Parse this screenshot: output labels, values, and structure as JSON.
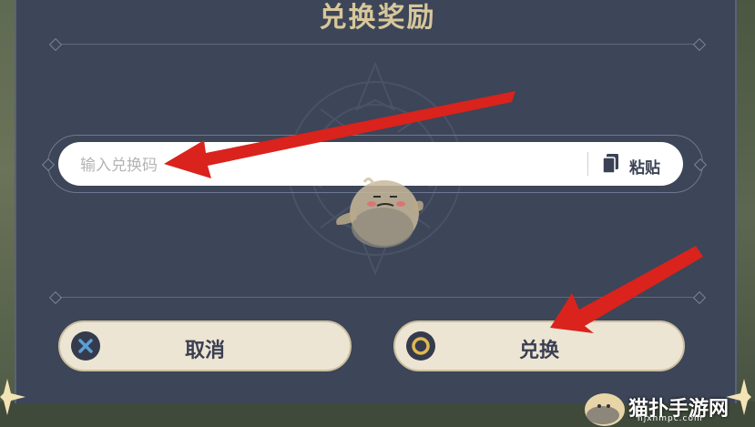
{
  "dialog": {
    "title": "兑换奖励",
    "input_placeholder": "输入兑换码",
    "paste_label": "粘贴",
    "cancel_label": "取消",
    "confirm_label": "兑换"
  },
  "watermark": {
    "site_name": "猫扑手游网",
    "site_url": "njxhmpc.com"
  },
  "colors": {
    "panel_bg": "#3d4558",
    "title_gold": "#d7c79a",
    "button_bg": "#ede5d3",
    "cancel_icon": "#5aa0d6",
    "confirm_icon": "#e0b850",
    "arrow_red": "#d9231c"
  },
  "icons": {
    "paste": "clipboard-icon",
    "cancel": "x-icon",
    "confirm": "circle-icon",
    "mascot": "paimon-mascot"
  }
}
